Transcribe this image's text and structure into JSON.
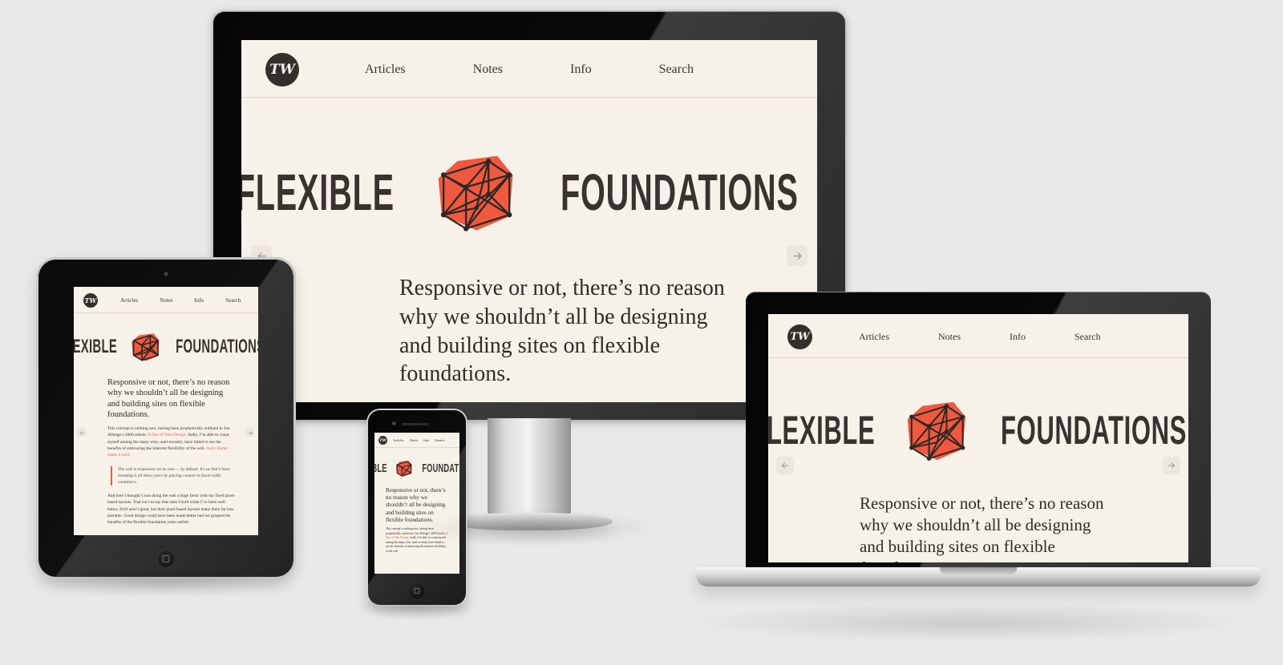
{
  "page": {
    "background_color": "#e8e8e8",
    "site_background_color": "#f6f1e9",
    "accent_color": "#ee5b46",
    "ink_color": "#33302c"
  },
  "nav": {
    "logo_text": "TW",
    "links": [
      {
        "label": "Articles"
      },
      {
        "label": "Notes"
      },
      {
        "label": "Info"
      },
      {
        "label": "Search"
      }
    ]
  },
  "headline": {
    "word_left": "FLEXIBLE",
    "word_right": "FOUNDATIONS",
    "cube_fill": "#f0583f",
    "cube_stroke": "#2c2925"
  },
  "article": {
    "lede": "Responsive or not, there’s no reason why we shouldn’t all be designing and building sites on flexible foundations.",
    "paragraph_1_before_link": "This concept is nothing new, having been prophetically outlined in Jon Allsopp’s 2000 article, ",
    "paragraph_1_link": "A Dao of Web Design",
    "paragraph_1_after_link": ". Sadly, I’m able to count myself among the many who, until recently, have failed to see the benefits of embracing the inherent flexibility of the web. ",
    "paragraph_1_link_2": "Andy Hume states it well",
    "paragraph_1_end": ":",
    "pullquote": "The web is responsive on its own — by default. It’s us that’s been breaking it all these years by placing content in fixed-width containers.",
    "paragraph_2": "And here I thought I was doing the web a huge favor with my fixed pixel-based layouts. That isn’t to say that sites I built while I’ve been well below 2010 aren’t good, but their pixel-based layouts make them far less portable. Good design could have been made better had we grasped the benefits of the flexible foundation years earlier."
  },
  "carousel": {
    "prev_icon": "arrow-left-icon",
    "next_icon": "arrow-right-icon"
  },
  "devices": [
    {
      "name": "desktop-monitor"
    },
    {
      "name": "laptop"
    },
    {
      "name": "tablet"
    },
    {
      "name": "smartphone"
    }
  ]
}
